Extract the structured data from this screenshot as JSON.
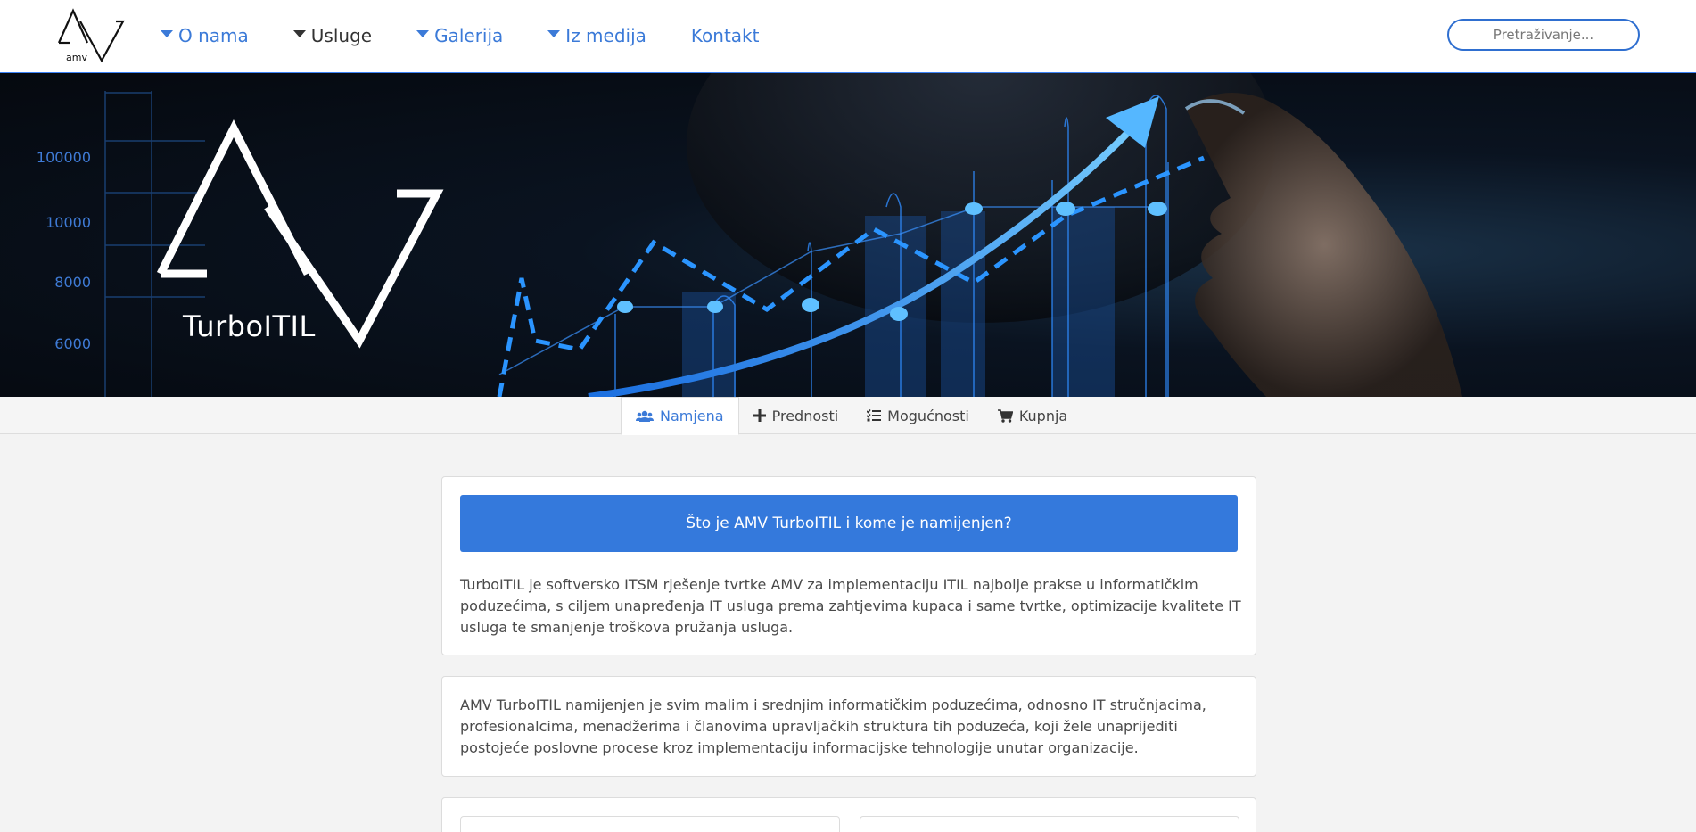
{
  "brand": {
    "logo_text": "amv",
    "logo_icon": "amv-logo-icon"
  },
  "nav": {
    "items": [
      {
        "label": "O nama",
        "has_dropdown": true,
        "active": false
      },
      {
        "label": "Usluge",
        "has_dropdown": true,
        "active": true
      },
      {
        "label": "Galerija",
        "has_dropdown": true,
        "active": false
      },
      {
        "label": "Iz medija",
        "has_dropdown": true,
        "active": false
      },
      {
        "label": "Kontakt",
        "has_dropdown": false,
        "active": false
      }
    ],
    "search_placeholder": "Pretraživanje..."
  },
  "hero": {
    "title": "TurboITIL",
    "axis_labels": [
      "100000",
      "10000",
      "8000",
      "6000"
    ]
  },
  "tabs": [
    {
      "label": "Namjena",
      "icon": "users-icon",
      "active": true
    },
    {
      "label": "Prednosti",
      "icon": "plus-icon",
      "active": false
    },
    {
      "label": "Mogućnosti",
      "icon": "tasks-icon",
      "active": false
    },
    {
      "label": "Kupnja",
      "icon": "cart-icon",
      "active": false
    }
  ],
  "content": {
    "heading": "Što je AMV TurboITIL i kome je namijenjen?",
    "paragraph1": "TurboITIL je softversko ITSM rješenje tvrtke AMV za implementaciju ITIL najbolje prakse u informatičkim poduzećima, s ciljem unapređenja IT usluga prema zahtjevima kupaca i same tvrtke, optimizacije kvalitete IT usluga te smanjenje troškova pružanja usluga.",
    "paragraph2": "AMV TurboITIL namijenjen je svim malim i srednjim informatičkim poduzećima, odnosno IT stručnjacima, profesionalcima, menadžerima i članovima upravljačkih struktura tih poduzeća, koji žele unaprijediti postojeće poslovne procese kroz implementaciju informacijske tehnologije unutar organizacije."
  },
  "colors": {
    "accent": "#3479dc",
    "link": "#3b7ad8",
    "hero_bg": "#05090f"
  }
}
